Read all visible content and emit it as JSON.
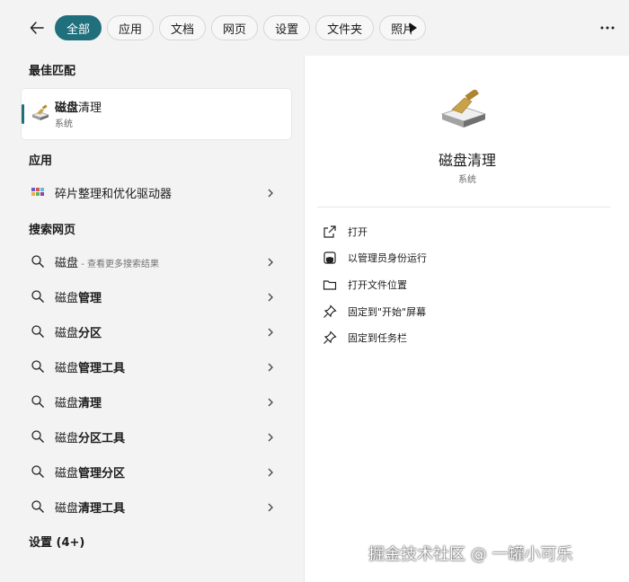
{
  "tabs": [
    "全部",
    "应用",
    "文档",
    "网页",
    "设置",
    "文件夹",
    "照片"
  ],
  "sections": {
    "best_match": "最佳匹配",
    "apps": "应用",
    "web_search": "搜索网页",
    "settings": "设置 (4+)"
  },
  "best_match": {
    "title_bold": "磁盘",
    "title_rest": "清理",
    "subtitle": "系统"
  },
  "apps": [
    {
      "label": "碎片整理和优化驱动器"
    }
  ],
  "web_results": [
    {
      "bold": "磁盘",
      "rest": "",
      "sub": " - 查看更多搜索结果"
    },
    {
      "bold": "磁盘",
      "rest": "管理",
      "sub": ""
    },
    {
      "bold": "磁盘",
      "rest": "分区",
      "sub": ""
    },
    {
      "bold": "磁盘",
      "rest": "管理工具",
      "sub": ""
    },
    {
      "bold": "磁盘",
      "rest": "清理",
      "sub": ""
    },
    {
      "bold": "磁盘",
      "rest": "分区工具",
      "sub": ""
    },
    {
      "bold": "磁盘",
      "rest": "管理分区",
      "sub": ""
    },
    {
      "bold": "磁盘",
      "rest": "清理工具",
      "sub": ""
    }
  ],
  "detail": {
    "title": "磁盘清理",
    "subtitle": "系统",
    "actions": [
      {
        "label": "打开",
        "icon": "open-external-icon"
      },
      {
        "label": "以管理员身份运行",
        "icon": "shield-admin-icon"
      },
      {
        "label": "打开文件位置",
        "icon": "folder-icon"
      },
      {
        "label": "固定到\"开始\"屏幕",
        "icon": "pin-icon"
      },
      {
        "label": "固定到任务栏",
        "icon": "pin-icon"
      }
    ]
  },
  "watermark": "掘金技术社区 @ 一罐小可乐",
  "colors": {
    "accent": "#1f6f7c",
    "background": "#f3f3f3",
    "panel": "#ffffff"
  }
}
